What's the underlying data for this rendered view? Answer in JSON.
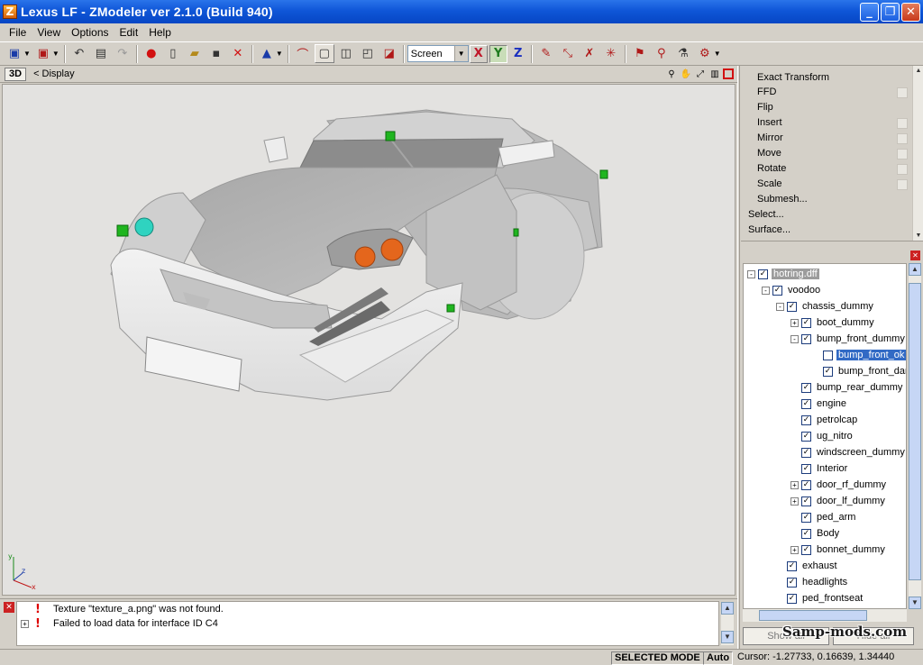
{
  "window": {
    "title": "Lexus LF - ZModeler ver 2.1.0 (Build 940)",
    "app_icon": "Z",
    "buttons": {
      "minimize": "_",
      "maximize": "❐",
      "close": "✕"
    }
  },
  "menu": [
    "File",
    "View",
    "Options",
    "Edit",
    "Help"
  ],
  "toolbar": {
    "coord_mode": "Screen",
    "axes": [
      "X",
      "Y",
      "Z"
    ]
  },
  "viewport": {
    "view_name": "3D",
    "breadcrumb": "< Display",
    "axis_gizmo": {
      "y": "y",
      "z": "z",
      "x": "x"
    }
  },
  "modifiers": {
    "items": [
      "Exact Transform",
      "FFD",
      "Flip",
      "Insert",
      "Mirror",
      "Move",
      "Rotate",
      "Scale",
      "Submesh..."
    ],
    "top_items": [
      "Select...",
      "Surface..."
    ]
  },
  "tree": {
    "rows": [
      {
        "label": "hotring.dff",
        "checked": true,
        "expander": "-",
        "state": "root"
      },
      {
        "label": "voodoo",
        "checked": true,
        "expander": "-",
        "state": ""
      },
      {
        "label": "chassis_dummy",
        "checked": true,
        "expander": "-",
        "state": ""
      },
      {
        "label": "boot_dummy",
        "checked": true,
        "expander": "+",
        "state": ""
      },
      {
        "label": "bump_front_dummy",
        "checked": true,
        "expander": "-",
        "state": ""
      },
      {
        "label": "bump_front_ok",
        "checked": false,
        "expander": "",
        "state": "selected"
      },
      {
        "label": "bump_front_dam",
        "checked": true,
        "expander": "",
        "state": ""
      },
      {
        "label": "bump_rear_dummy",
        "checked": true,
        "expander": "",
        "state": ""
      },
      {
        "label": "engine",
        "checked": true,
        "expander": "",
        "state": ""
      },
      {
        "label": "petrolcap",
        "checked": true,
        "expander": "",
        "state": ""
      },
      {
        "label": "ug_nitro",
        "checked": true,
        "expander": "",
        "state": ""
      },
      {
        "label": "windscreen_dummy",
        "checked": true,
        "expander": "",
        "state": ""
      },
      {
        "label": "Interior",
        "checked": true,
        "expander": "",
        "state": ""
      },
      {
        "label": "door_rf_dummy",
        "checked": true,
        "expander": "+",
        "state": ""
      },
      {
        "label": "door_lf_dummy",
        "checked": true,
        "expander": "+",
        "state": ""
      },
      {
        "label": "ped_arm",
        "checked": true,
        "expander": "",
        "state": ""
      },
      {
        "label": "Body",
        "checked": true,
        "expander": "",
        "state": ""
      },
      {
        "label": "bonnet_dummy",
        "checked": true,
        "expander": "+",
        "state": ""
      },
      {
        "label": "exhaust",
        "checked": true,
        "expander": "",
        "state": ""
      },
      {
        "label": "headlights",
        "checked": true,
        "expander": "",
        "state": ""
      },
      {
        "label": "ped_frontseat",
        "checked": true,
        "expander": "",
        "state": ""
      }
    ],
    "show_all": "Show all",
    "hide_all": "Hide all"
  },
  "log": [
    {
      "text": "Texture \"texture_a.png\" was not found.",
      "expandable": false
    },
    {
      "text": "Failed to load data for interface ID C4",
      "expandable": true
    }
  ],
  "status": {
    "mode": "SELECTED MODE",
    "auto": "Auto",
    "cursor": "Cursor: -1.27733, 0.16639, 1.34440"
  },
  "watermark": "Samp-mods.com",
  "colors": {
    "titlebar": "#0f56d8",
    "selection": "#316ac5",
    "viewport_bg": "#e3e2e0",
    "car_body": "#d9d9d9",
    "dummy_green": "#1fb51f",
    "light_orange": "#e4661c",
    "light_cyan": "#2fd3c0"
  }
}
